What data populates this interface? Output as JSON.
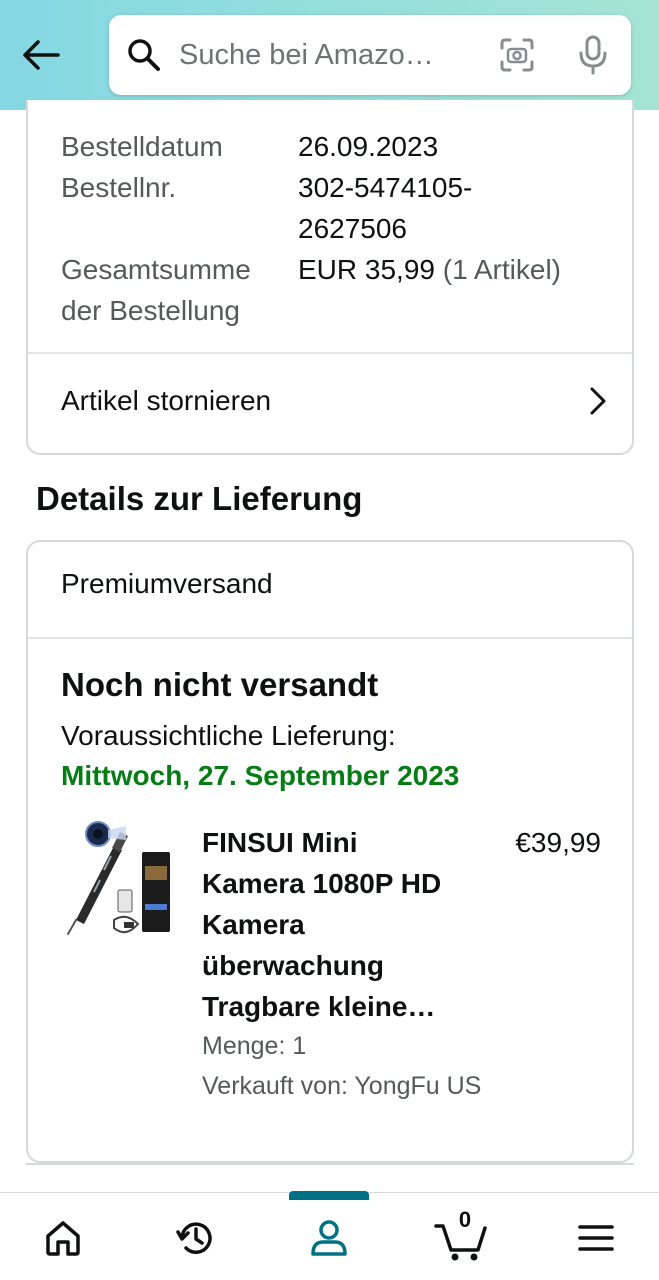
{
  "header": {
    "search_placeholder": "Suche bei Amazo…"
  },
  "order_info": {
    "date_label": "Bestelldatum",
    "date_value": "26.09.2023",
    "number_label": "Bestellnr.",
    "number_value_line1": "302-5474105-",
    "number_value_line2": "2627506",
    "total_label_line1": "Gesamtsumme",
    "total_label_line2": "der Bestellung",
    "total_value": "EUR 35,99",
    "total_items": "(1 Artikel)",
    "cancel_label": "Artikel stornieren"
  },
  "delivery": {
    "section_title": "Details zur Lieferung",
    "shipping_type": "Premiumversand",
    "status": "Noch nicht versandt",
    "estimate_label": "Voraussichtliche Lieferung:",
    "estimate_date": "Mittwoch, 27. September 2023",
    "product": {
      "title_lines": [
        "FINSUI Mini",
        "Kamera 1080P HD",
        "Kamera",
        "überwachung",
        "Tragbare kleine…"
      ],
      "price": "€39,99",
      "quantity": "Menge: 1",
      "seller": "Verkauft von: YongFu US"
    }
  },
  "bottom_nav": {
    "cart_count": "0",
    "active": "account"
  },
  "colors": {
    "header_gradient_start": "#84d8e3",
    "header_gradient_end": "#a5e4d4",
    "delivery_green": "#067d14",
    "active_teal": "#007185"
  }
}
